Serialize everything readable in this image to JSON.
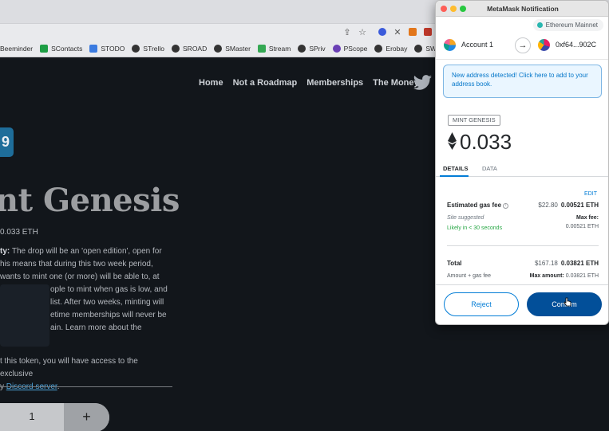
{
  "bookmarks": [
    {
      "label": "Beeminder",
      "color": "#e7e7e7"
    },
    {
      "label": "SContacts",
      "color": "#1e9e45"
    },
    {
      "label": "STODO",
      "color": "#3b7be0"
    },
    {
      "label": "STrello",
      "color": "#333333"
    },
    {
      "label": "SROAD",
      "color": "#333333"
    },
    {
      "label": "SMaster",
      "color": "#333333"
    },
    {
      "label": "Stream",
      "color": "#34a853"
    },
    {
      "label": "SPriv",
      "color": "#333333"
    },
    {
      "label": "PScope",
      "color": "#6a3fb5"
    },
    {
      "label": "Erobay",
      "color": "#333333"
    },
    {
      "label": "SW",
      "color": "#333333"
    }
  ],
  "site": {
    "nav": [
      "Home",
      "Not a Roadmap",
      "Memberships",
      "The Money"
    ],
    "badge_text": "9",
    "hero_title": "nt Genesis",
    "price": "0.033 ETH",
    "desc_strong": "ty:",
    "desc_lines": [
      "The drop will be an 'open edition', open for",
      "his means that during this two week period,",
      "wants to mint one (or more) will be able to, at",
      "ople to mint when gas is low, and",
      "list. After two weeks, minting will",
      "etime memberships will never be",
      "ain. Learn more about the Genesis"
    ],
    "access_line1": "t this token, you will have access to the exclusive",
    "access_prefix": "y ",
    "access_link": "Discord server",
    "access_suffix": ".",
    "quantity": "1",
    "plus": "+"
  },
  "metamask": {
    "window_title": "MetaMask Notification",
    "network": "Ethereum Mainnet",
    "account_name": "Account 1",
    "to_address": "0xf64...902C",
    "notice": "New address detected! Click here to add to your address book.",
    "method": "MINT GENESIS",
    "amount": "0.033",
    "tabs": {
      "details": "DETAILS",
      "data": "DATA"
    },
    "edit": "EDIT",
    "gas": {
      "label": "Estimated gas fee",
      "usd": "$22.80",
      "eth": "0.00521 ETH",
      "suggested": "Site suggested",
      "max_fee_label": "Max fee:",
      "max_fee": "0.00521 ETH",
      "likely": "Likely in < 30 seconds"
    },
    "total": {
      "label": "Total",
      "usd": "$167.18",
      "eth": "0.03821 ETH",
      "sub": "Amount + gas fee",
      "max_amount_label": "Max amount:",
      "max_amount": "0.03821 ETH"
    },
    "buttons": {
      "reject": "Reject",
      "confirm": "Confirm"
    },
    "colors": {
      "primary": "#037dd6",
      "confirm_bg": "#024f99",
      "network_dot": "#29b6af"
    }
  }
}
